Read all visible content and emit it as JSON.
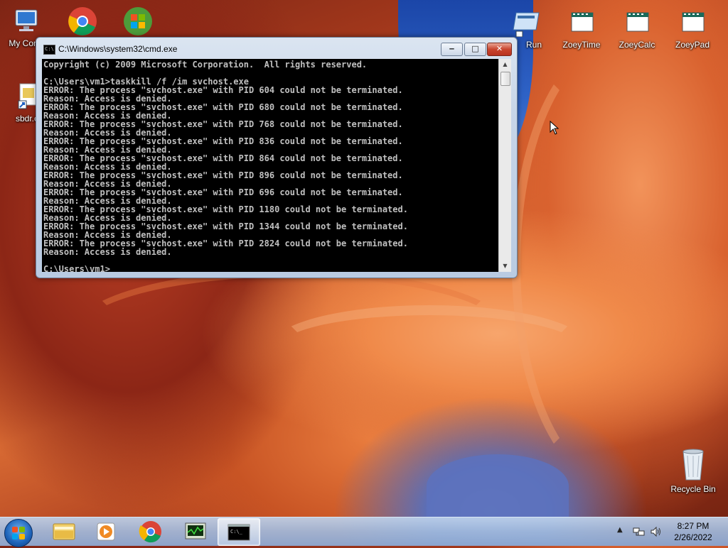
{
  "desktop": {
    "icons_left": [
      {
        "label": "My Comp",
        "icon": "computer-icon"
      },
      {
        "label": "sbdr.c",
        "icon": "file-shortcut-icon"
      }
    ],
    "icons_top": [
      {
        "label": "",
        "icon": "chrome-icon"
      },
      {
        "label": "",
        "icon": "windows-update-icon"
      },
      {
        "label": "Run",
        "icon": "run-icon"
      },
      {
        "label": "ZoeyTime",
        "icon": "film-icon"
      },
      {
        "label": "ZoeyCalc",
        "icon": "film-icon"
      },
      {
        "label": "ZoeyPad",
        "icon": "film-icon"
      }
    ],
    "recycle_bin": {
      "label": "Recycle Bin",
      "icon": "recycle-bin-icon"
    }
  },
  "cmd_window": {
    "title": "C:\\Windows\\system32\\cmd.exe",
    "buttons": {
      "minimize": "‒",
      "maximize": "□",
      "close": "✕"
    },
    "console_lines": [
      "Copyright (c) 2009 Microsoft Corporation.  All rights reserved.",
      "",
      "C:\\Users\\vm1>taskkill /f /im svchost.exe",
      "ERROR: The process \"svchost.exe\" with PID 604 could not be terminated.",
      "Reason: Access is denied.",
      "ERROR: The process \"svchost.exe\" with PID 680 could not be terminated.",
      "Reason: Access is denied.",
      "ERROR: The process \"svchost.exe\" with PID 768 could not be terminated.",
      "Reason: Access is denied.",
      "ERROR: The process \"svchost.exe\" with PID 836 could not be terminated.",
      "Reason: Access is denied.",
      "ERROR: The process \"svchost.exe\" with PID 864 could not be terminated.",
      "Reason: Access is denied.",
      "ERROR: The process \"svchost.exe\" with PID 896 could not be terminated.",
      "Reason: Access is denied.",
      "ERROR: The process \"svchost.exe\" with PID 696 could not be terminated.",
      "Reason: Access is denied.",
      "ERROR: The process \"svchost.exe\" with PID 1180 could not be terminated.",
      "Reason: Access is denied.",
      "ERROR: The process \"svchost.exe\" with PID 1344 could not be terminated.",
      "Reason: Access is denied.",
      "ERROR: The process \"svchost.exe\" with PID 2824 could not be terminated.",
      "Reason: Access is denied.",
      "",
      "C:\\Users\\vm1>"
    ]
  },
  "taskbar": {
    "items": [
      {
        "icon": "windows-explorer-icon"
      },
      {
        "icon": "media-player-icon"
      },
      {
        "icon": "chrome-icon"
      },
      {
        "icon": "task-manager-icon"
      },
      {
        "icon": "cmd-icon",
        "active": true
      }
    ],
    "tray": {
      "icons": [
        "show-hidden-icons-chevron-icon",
        "network-icon",
        "volume-icon"
      ]
    },
    "clock": {
      "time": "8:27 PM",
      "date": "2/26/2022"
    }
  },
  "colors": {
    "console_bg": "#000000",
    "console_fg": "#c0c0c0",
    "close_button": "#c9452e"
  }
}
